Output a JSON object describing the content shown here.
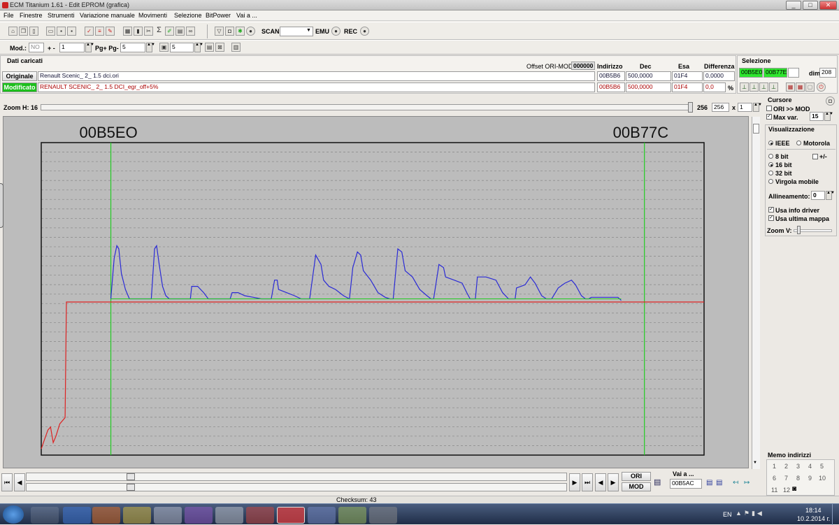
{
  "window": {
    "title": "ECM Titanium 1.61 - Edit EPROM (grafica)",
    "min": "_",
    "max": "□",
    "close": "✕"
  },
  "menu": [
    "File",
    "Finestre",
    "Strumenti",
    "Variazione manuale",
    "Movimenti",
    "Selezione",
    "BitPower",
    "Vai a ..."
  ],
  "toolbar": {
    "scan_label": "SCAN",
    "emu_label": "EMU",
    "rec_label": "REC"
  },
  "toolbar2": {
    "mod_label": "Mod.:",
    "mod_value": "NO",
    "plusminus_label": "+ -",
    "step_value": "1",
    "pg_label": "Pg+ Pg-",
    "pg_value": "5",
    "map_value": "5"
  },
  "loaded": {
    "title": "Dati caricati",
    "offset_label": "Offset ORI-MOD",
    "offset_value": "000000",
    "headers": {
      "address": "Indirizzo",
      "dec": "Dec",
      "hex": "Esa",
      "diff": "Differenza"
    },
    "original": {
      "label": "Originale",
      "file": "Renault Scenic_ 2_ 1.5 dci.ori",
      "address": "00B5B6",
      "dec": "500,0000",
      "hex": "01F4",
      "diff": "0,0000"
    },
    "modified": {
      "label": "Modificato",
      "file": "RENAULT SCENIC_ 2_ 1.5 DCI_egr_off+5%",
      "address": "00B5B6",
      "dec": "500,0000",
      "hex": "01F4",
      "diff": "0,0",
      "unit": "%"
    }
  },
  "selection": {
    "title": "Selezione",
    "start": "00B5E0",
    "end": "00B77E",
    "dim_label": "dim.",
    "dim_value": "208"
  },
  "zoom": {
    "label": "Zoom H: 16",
    "value1": "256",
    "value2": "256",
    "x_label": "x",
    "factor": "1"
  },
  "cursor": {
    "title": "Cursore",
    "ori_mod": "ORI >> MOD",
    "maxvar_label": "Max var.",
    "maxvar_value": "15"
  },
  "view": {
    "title": "Visualizzazione",
    "ieee": "IEEE",
    "motorola": "Motorola",
    "bit8": "8 bit",
    "plusminus": "+/-",
    "bit16": "16 bit",
    "bit32": "32 bit",
    "float": "Virgola mobile",
    "align_label": "Allineamento:",
    "align_value": "0",
    "info_driver": "Usa info driver",
    "last_map": "Usa ultima mappa",
    "zoomv": "Zoom V:"
  },
  "memo": {
    "title": "Memo indirizzi",
    "numbers": [
      "1",
      "2",
      "3",
      "4",
      "5",
      "6",
      "7",
      "8",
      "9",
      "10",
      "11",
      "12"
    ]
  },
  "bottom": {
    "ori": "ORI",
    "mod": "MOD",
    "goto_label": "Vai a ...",
    "goto_value": "00B5AC",
    "checksum": "Checksum: 43"
  },
  "clock": {
    "lang": "EN",
    "time": "18:14",
    "date": "10.2.2014 г."
  },
  "colors": {
    "original_line": "#dd2222",
    "modified_line": "#2a2ad6",
    "marker": "#22cc22",
    "grid_bg": "#bcbcbc"
  },
  "chart_data": {
    "type": "line",
    "markers": [
      {
        "label": "00B5EO"
      },
      {
        "label": "00B77C"
      }
    ],
    "grid": true,
    "series": [
      {
        "color": "#dd2222",
        "points": [
          [
            0,
            0.02
          ],
          [
            0.005,
            0.05
          ],
          [
            0.01,
            0.08
          ],
          [
            0.014,
            0.09
          ],
          [
            0.018,
            0.04
          ],
          [
            0.022,
            0.06
          ],
          [
            0.028,
            0.1
          ],
          [
            0.036,
            0.12
          ],
          [
            0.038,
            0.49
          ],
          [
            0.043,
            0.49
          ],
          [
            0.1,
            0.49
          ],
          [
            0.2,
            0.49
          ],
          [
            0.4,
            0.49
          ],
          [
            0.6,
            0.49
          ],
          [
            0.8,
            0.49
          ],
          [
            1,
            0.49
          ]
        ]
      },
      {
        "color": "#2a2ad6",
        "points": [
          [
            0.105,
            0.5
          ],
          [
            0.11,
            0.63
          ],
          [
            0.114,
            0.67
          ],
          [
            0.117,
            0.66
          ],
          [
            0.121,
            0.58
          ],
          [
            0.127,
            0.53
          ],
          [
            0.133,
            0.5
          ],
          [
            0.166,
            0.5
          ],
          [
            0.171,
            0.66
          ],
          [
            0.174,
            0.67
          ],
          [
            0.178,
            0.61
          ],
          [
            0.183,
            0.54
          ],
          [
            0.188,
            0.51
          ],
          [
            0.193,
            0.5
          ],
          [
            0.225,
            0.5
          ],
          [
            0.227,
            0.54
          ],
          [
            0.236,
            0.54
          ],
          [
            0.245,
            0.52
          ],
          [
            0.252,
            0.5
          ],
          [
            0.285,
            0.5
          ],
          [
            0.288,
            0.52
          ],
          [
            0.297,
            0.52
          ],
          [
            0.307,
            0.51
          ],
          [
            0.32,
            0.505
          ],
          [
            0.332,
            0.5
          ],
          [
            0.347,
            0.5
          ],
          [
            0.352,
            0.56
          ],
          [
            0.356,
            0.56
          ],
          [
            0.358,
            0.53
          ],
          [
            0.37,
            0.52
          ],
          [
            0.382,
            0.51
          ],
          [
            0.392,
            0.5
          ],
          [
            0.405,
            0.5
          ],
          [
            0.414,
            0.64
          ],
          [
            0.422,
            0.61
          ],
          [
            0.426,
            0.56
          ],
          [
            0.434,
            0.54
          ],
          [
            0.444,
            0.53
          ],
          [
            0.456,
            0.51
          ],
          [
            0.465,
            0.5
          ],
          [
            0.47,
            0.6
          ],
          [
            0.477,
            0.65
          ],
          [
            0.482,
            0.64
          ],
          [
            0.486,
            0.59
          ],
          [
            0.497,
            0.56
          ],
          [
            0.508,
            0.52
          ],
          [
            0.519,
            0.505
          ],
          [
            0.526,
            0.5
          ],
          [
            0.531,
            0.5
          ],
          [
            0.538,
            0.66
          ],
          [
            0.544,
            0.65
          ],
          [
            0.549,
            0.59
          ],
          [
            0.56,
            0.57
          ],
          [
            0.571,
            0.53
          ],
          [
            0.582,
            0.51
          ],
          [
            0.588,
            0.5
          ],
          [
            0.592,
            0.5
          ],
          [
            0.6,
            0.61
          ],
          [
            0.607,
            0.6
          ],
          [
            0.61,
            0.57
          ],
          [
            0.623,
            0.56
          ],
          [
            0.635,
            0.55
          ],
          [
            0.642,
            0.52
          ],
          [
            0.647,
            0.5
          ],
          [
            0.655,
            0.5
          ],
          [
            0.658,
            0.57
          ],
          [
            0.671,
            0.57
          ],
          [
            0.686,
            0.56
          ],
          [
            0.696,
            0.52
          ],
          [
            0.705,
            0.5
          ],
          [
            0.715,
            0.5
          ],
          [
            0.717,
            0.535
          ],
          [
            0.73,
            0.545
          ],
          [
            0.738,
            0.57
          ],
          [
            0.745,
            0.55
          ],
          [
            0.755,
            0.51
          ],
          [
            0.762,
            0.5
          ],
          [
            0.77,
            0.5
          ],
          [
            0.78,
            0.535
          ],
          [
            0.79,
            0.55
          ],
          [
            0.8,
            0.56
          ],
          [
            0.806,
            0.545
          ],
          [
            0.815,
            0.51
          ],
          [
            0.821,
            0.5
          ],
          [
            0.826,
            0.5
          ],
          [
            0.83,
            0.505
          ],
          [
            0.87,
            0.505
          ],
          [
            0.875,
            0.495
          ]
        ]
      },
      {
        "color": "#22cc22",
        "points": [
          [
            0.105,
            0.5
          ],
          [
            0.875,
            0.5
          ]
        ]
      }
    ]
  }
}
